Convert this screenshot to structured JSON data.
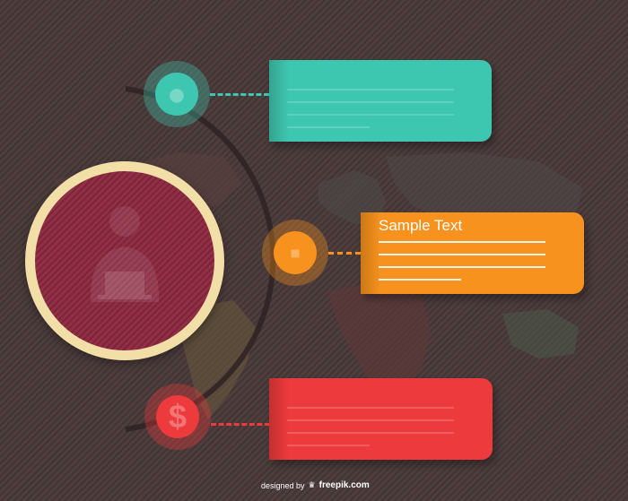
{
  "colors": {
    "background": "#4a3a3a",
    "hub_fill": "#8c2840",
    "hub_ring": "#f2dfa8",
    "teal": "#3ec7b0",
    "orange": "#f7921e",
    "red": "#ed3a3c"
  },
  "items": [
    {
      "title": "",
      "color": "#3ec7b0",
      "icon": "user-icon"
    },
    {
      "title": "Sample Text",
      "color": "#f7921e",
      "icon": "chat-icon"
    },
    {
      "title": "",
      "color": "#ed3a3c",
      "icon": "dollar-icon"
    }
  ],
  "hub": {
    "icon": "person-at-laptop-icon"
  },
  "credit": {
    "prefix": "designed by",
    "brand": "freepik.com",
    "logo_icon": "crown-icon"
  }
}
